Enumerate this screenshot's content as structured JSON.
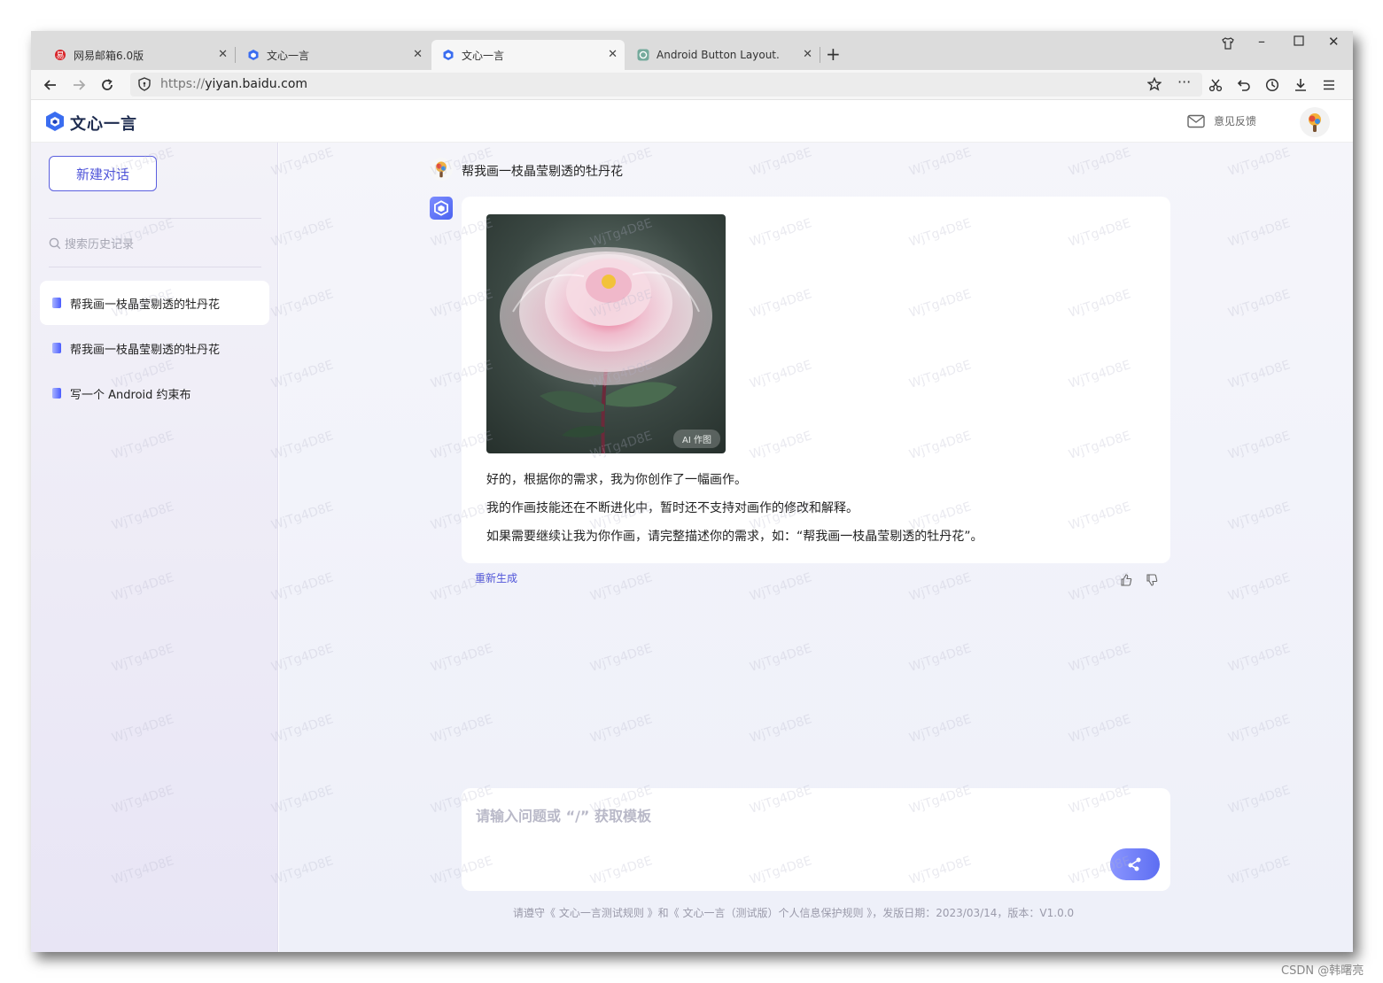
{
  "browser": {
    "tabs": [
      {
        "title": "网易邮箱6.0版",
        "active": false
      },
      {
        "title": "文心一言",
        "active": false
      },
      {
        "title": "文心一言",
        "active": true
      },
      {
        "title": "Android Button Layout.",
        "active": false
      }
    ],
    "url_scheme": "https://",
    "url_host": "yiyan.baidu.com"
  },
  "header": {
    "brand_name": "文心一言",
    "feedback_label": "意见反馈"
  },
  "sidebar": {
    "new_chat_label": "新建对话",
    "search_placeholder": "搜索历史记录",
    "history": [
      {
        "label": "帮我画一枝晶莹剔透的牡丹花",
        "active": true
      },
      {
        "label": "帮我画一枝晶莹剔透的牡丹花",
        "active": false
      },
      {
        "label": "写一个 Android 约束布",
        "active": false
      }
    ]
  },
  "chat": {
    "user_message": "帮我画一枝晶莹剔透的牡丹花",
    "image_tag": "AI 作图",
    "reply_lines": [
      "好的，根据你的需求，我为你创作了一幅画作。",
      "我的作画技能还在不断进化中，暂时还不支持对画作的修改和解释。",
      "如果需要继续让我为你作画，请完整描述你的需求，如：“帮我画一枝晶莹剔透的牡丹花”。"
    ],
    "regenerate_label": "重新生成"
  },
  "input": {
    "placeholder": "请输入问题或 “/” 获取模板"
  },
  "footer": {
    "text": "请遵守《 文心一言测试规则 》和《 文心一言（测试版）个人信息保护规则 》，发版日期：2023/03/14，版本：V1.0.0"
  },
  "watermark": "WjTg4D8E",
  "credit": "CSDN @韩曙亮",
  "colors": {
    "accent": "#4f54d9",
    "brand_blue": "#3a6df0"
  }
}
